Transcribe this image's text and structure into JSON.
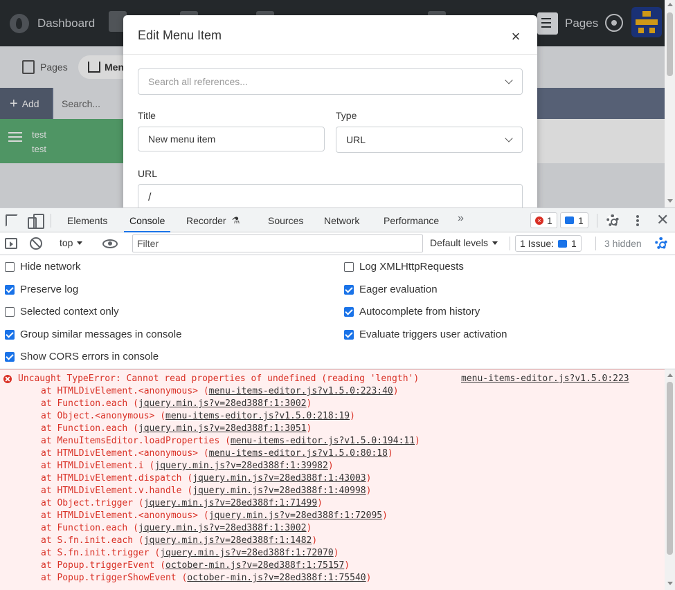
{
  "app": {
    "nav_dashboard": "Dashboard",
    "nav_pages": "Pages",
    "subtabs": {
      "pages": "Pages",
      "menus": "Men"
    },
    "toolbar": {
      "add_label": "Add",
      "search_placeholder": "Search..."
    },
    "tree_item": {
      "line1": "test",
      "line2": "test"
    }
  },
  "modal": {
    "title": "Edit Menu Item",
    "close_glyph": "×",
    "reference_placeholder": "Search all references...",
    "title_label": "Title",
    "title_value": "New menu item",
    "type_label": "Type",
    "type_value": "URL",
    "url_label": "URL",
    "url_value": "/"
  },
  "devtools": {
    "tabs": [
      "Elements",
      "Console",
      "Recorder",
      "Sources",
      "Network",
      "Performance"
    ],
    "recorder_suffix": "⚗",
    "more_tabs": "»",
    "error_count": "1",
    "message_count": "1",
    "close_glyph": "✕",
    "context": "top",
    "filter_placeholder": "Filter",
    "levels": "Default levels",
    "issues_label": "1 Issue:",
    "issues_count": "1",
    "hidden": "3 hidden"
  },
  "console_settings": {
    "left": [
      {
        "label": "Hide network",
        "checked": false
      },
      {
        "label": "Preserve log",
        "checked": true
      },
      {
        "label": "Selected context only",
        "checked": false
      },
      {
        "label": "Group similar messages in console",
        "checked": true
      },
      {
        "label": "Show CORS errors in console",
        "checked": true
      }
    ],
    "right": [
      {
        "label": "Log XMLHttpRequests",
        "checked": false
      },
      {
        "label": "Eager evaluation",
        "checked": true
      },
      {
        "label": "Autocomplete from history",
        "checked": true
      },
      {
        "label": "Evaluate triggers user activation",
        "checked": true
      }
    ]
  },
  "error": {
    "message": "Uncaught TypeError: Cannot read properties of undefined (reading 'length')",
    "source": "menu-items-editor.js?v1.5.0:223",
    "stack": [
      {
        "fn": "at HTMLDivElement.<anonymous> ",
        "loc": "menu-items-editor.js?v1.5.0:223:40"
      },
      {
        "fn": "at Function.each ",
        "loc": "jquery.min.js?v=28ed388f:1:3002"
      },
      {
        "fn": "at Object.<anonymous> ",
        "loc": "menu-items-editor.js?v1.5.0:218:19"
      },
      {
        "fn": "at Function.each ",
        "loc": "jquery.min.js?v=28ed388f:1:3051"
      },
      {
        "fn": "at MenuItemsEditor.loadProperties ",
        "loc": "menu-items-editor.js?v1.5.0:194:11"
      },
      {
        "fn": "at HTMLDivElement.<anonymous> ",
        "loc": "menu-items-editor.js?v1.5.0:80:18"
      },
      {
        "fn": "at HTMLDivElement.i ",
        "loc": "jquery.min.js?v=28ed388f:1:39982"
      },
      {
        "fn": "at HTMLDivElement.dispatch ",
        "loc": "jquery.min.js?v=28ed388f:1:43003"
      },
      {
        "fn": "at HTMLDivElement.v.handle ",
        "loc": "jquery.min.js?v=28ed388f:1:40998"
      },
      {
        "fn": "at Object.trigger ",
        "loc": "jquery.min.js?v=28ed388f:1:71499"
      },
      {
        "fn": "at HTMLDivElement.<anonymous> ",
        "loc": "jquery.min.js?v=28ed388f:1:72095"
      },
      {
        "fn": "at Function.each ",
        "loc": "jquery.min.js?v=28ed388f:1:3002"
      },
      {
        "fn": "at S.fn.init.each ",
        "loc": "jquery.min.js?v=28ed388f:1:1482"
      },
      {
        "fn": "at S.fn.init.trigger ",
        "loc": "jquery.min.js?v=28ed388f:1:72070"
      },
      {
        "fn": "at Popup.triggerEvent ",
        "loc": "october-min.js?v=28ed388f:1:75157"
      },
      {
        "fn": "at Popup.triggerShowEvent ",
        "loc": "october-min.js?v=28ed388f:1:75540"
      }
    ]
  }
}
